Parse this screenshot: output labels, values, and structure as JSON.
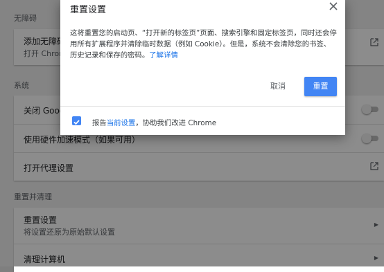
{
  "settings": {
    "accessibility": {
      "heading": "无障碍",
      "add_title": "添加无障碍",
      "add_sub": "打开 Chrom"
    },
    "system": {
      "heading": "系统",
      "bg_apps": "关闭 Googl",
      "hw_accel": "使用硬件加速模式（如果可用）",
      "proxy": "打开代理设置"
    },
    "reset": {
      "heading": "重置并清理",
      "reset_title": "重置设置",
      "reset_sub": "将设置还原为原始默认设置",
      "cleanup": "清理计算机"
    }
  },
  "dialog": {
    "title": "重置设置",
    "body_line1": "这将重置您的启动页、“打开新的标签页”页面、搜索引擎和固定标签页，同时还会停",
    "body_line2": "用所有扩展程序并清除临时数据（例如 Cookie）。但是，系统不会清除您的书签、",
    "body_line3": "历史记录和保存的密码。",
    "learn_more": "了解详情",
    "cancel_label": "取消",
    "reset_label": "重置",
    "report_prefix": "报告",
    "report_link": "当前设置",
    "report_suffix": "，协助我们改进 Chrome",
    "report_checked": true
  },
  "colors": {
    "accent": "#4285f4",
    "link": "#1a73e8",
    "scrim": "#000000"
  }
}
